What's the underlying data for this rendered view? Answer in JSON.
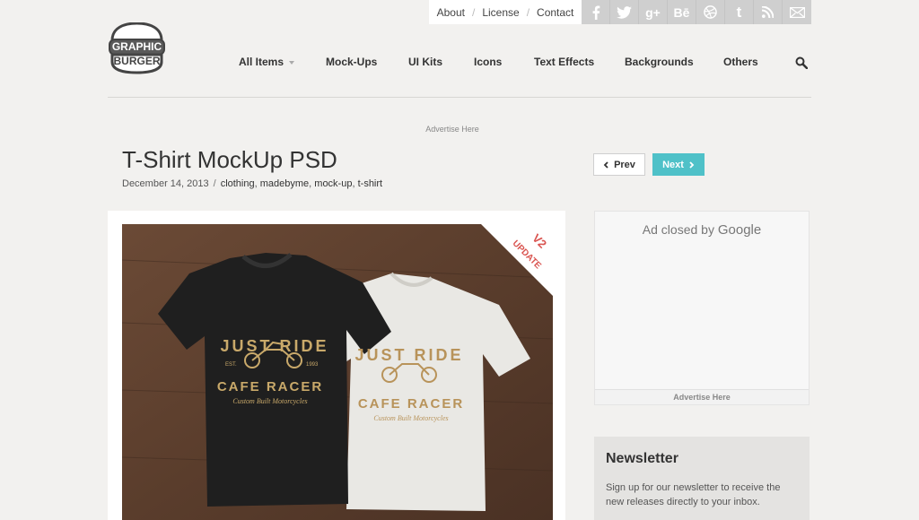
{
  "top_links": {
    "about": "About",
    "license": "License",
    "contact": "Contact",
    "separator": "/"
  },
  "social": [
    {
      "name": "facebook-icon",
      "glyph": "f"
    },
    {
      "name": "twitter-icon",
      "glyph": "t"
    },
    {
      "name": "google-plus-icon",
      "glyph": "g+"
    },
    {
      "name": "behance-icon",
      "glyph": "Bē"
    },
    {
      "name": "dribbble-icon",
      "glyph": "◍"
    },
    {
      "name": "tumblr-icon",
      "glyph": "t"
    },
    {
      "name": "rss-icon",
      "glyph": "rss"
    },
    {
      "name": "mail-icon",
      "glyph": "✉"
    }
  ],
  "logo": {
    "line1": "GRAPHIC",
    "line2": "BURGER"
  },
  "nav": {
    "all_items": "All Items",
    "mockups": "Mock-Ups",
    "ui_kits": "UI Kits",
    "icons": "Icons",
    "text_effects": "Text Effects",
    "backgrounds": "Backgrounds",
    "others": "Others"
  },
  "ad_top": "Advertise Here",
  "post": {
    "title": "T-Shirt MockUp PSD",
    "date": "December 14, 2013",
    "tags": [
      "clothing",
      "madebyme",
      "mock-up",
      "t-shirt"
    ],
    "prev_label": "Prev",
    "next_label": "Next"
  },
  "preview": {
    "ribbon_line1": "V2",
    "ribbon_line2": "UPDATE",
    "shirt_text1": "JUST RIDE",
    "shirt_text2": "CAFE RACER",
    "shirt_text3": "Custom Built Motorcycles",
    "est": "EST.",
    "year": "1993"
  },
  "ad_box": {
    "closed_text": "Ad closed by",
    "google": "Google",
    "footer": "Advertise Here"
  },
  "newsletter": {
    "title": "Newsletter",
    "text": "Sign up for our newsletter to receive the new releases directly to your inbox."
  },
  "colors": {
    "accent": "#4fc1c8",
    "background": "#f2f1ef",
    "ribbon": "#d9534f"
  }
}
